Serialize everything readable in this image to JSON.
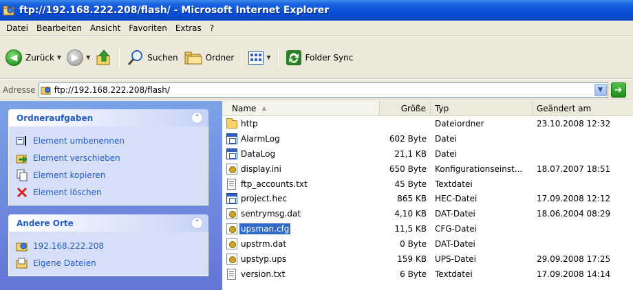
{
  "window": {
    "title": "ftp://192.168.222.208/flash/ - Microsoft Internet Explorer"
  },
  "menu": [
    "Datei",
    "Bearbeiten",
    "Ansicht",
    "Favoriten",
    "Extras",
    "?"
  ],
  "toolbar": {
    "back_label": "Zurück",
    "search_label": "Suchen",
    "folders_label": "Ordner",
    "sync_label": "Folder Sync"
  },
  "address": {
    "label": "Adresse",
    "value": "ftp://192.168.222.208/flash/"
  },
  "sidebar": {
    "tasks": {
      "title": "Ordneraufgaben",
      "items": [
        {
          "label": "Element umbenennen",
          "icon": "rename-icon"
        },
        {
          "label": "Element verschieben",
          "icon": "move-icon"
        },
        {
          "label": "Element kopieren",
          "icon": "copy-icon"
        },
        {
          "label": "Element löschen",
          "icon": "delete-icon"
        }
      ]
    },
    "places": {
      "title": "Andere Orte",
      "items": [
        {
          "label": "192.168.222.208",
          "icon": "ftp-server-icon"
        },
        {
          "label": "Eigene Dateien",
          "icon": "my-documents-icon"
        }
      ]
    }
  },
  "columns": {
    "name": "Name",
    "size": "Größe",
    "type": "Typ",
    "modified": "Geändert am"
  },
  "files": [
    {
      "name": "http",
      "size": "",
      "type": "Dateiordner",
      "modified": "23.10.2008 12:32",
      "icon": "folder"
    },
    {
      "name": "AlarmLog",
      "size": "602 Byte",
      "type": "Datei",
      "modified": "",
      "icon": "app"
    },
    {
      "name": "DataLog",
      "size": "21,1 KB",
      "type": "Datei",
      "modified": "",
      "icon": "app"
    },
    {
      "name": "display.ini",
      "size": "650 Byte",
      "type": "Konfigurationseinst...",
      "modified": "18.07.2007 18:51",
      "icon": "gear"
    },
    {
      "name": "ftp_accounts.txt",
      "size": "45 Byte",
      "type": "Textdatei",
      "modified": "",
      "icon": "txt"
    },
    {
      "name": "project.hec",
      "size": "865 KB",
      "type": "HEC-Datei",
      "modified": "17.09.2008 12:12",
      "icon": "app"
    },
    {
      "name": "sentrymsg.dat",
      "size": "4,10 KB",
      "type": "DAT-Datei",
      "modified": "18.06.2004 08:29",
      "icon": "gear"
    },
    {
      "name": "upsman.cfg",
      "size": "11,5 KB",
      "type": "CFG-Datei",
      "modified": "",
      "icon": "gear",
      "selected": true
    },
    {
      "name": "upstrm.dat",
      "size": "0 Byte",
      "type": "DAT-Datei",
      "modified": "",
      "icon": "gear"
    },
    {
      "name": "upstyp.ups",
      "size": "159 KB",
      "type": "UPS-Datei",
      "modified": "29.09.2008 17:25",
      "icon": "gear"
    },
    {
      "name": "version.txt",
      "size": "6 Byte",
      "type": "Textdatei",
      "modified": "17.09.2008 14:14",
      "icon": "txt"
    }
  ]
}
